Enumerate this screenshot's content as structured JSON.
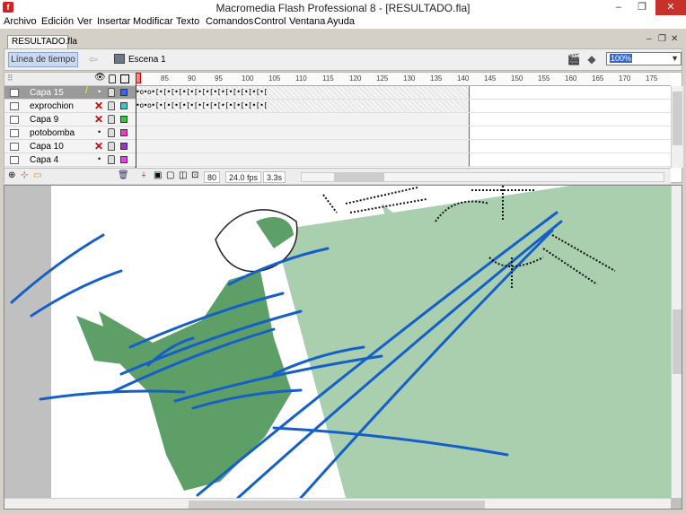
{
  "window": {
    "title": "Macromedia Flash Professional 8 - [RESULTADO.fla]",
    "app_icon": "flash-icon",
    "controls": [
      "minimize",
      "restore",
      "close"
    ]
  },
  "menu": [
    "Archivo",
    "Edición",
    "Ver",
    "Insertar",
    "Modificar",
    "Texto",
    "Comandos",
    "Control",
    "Ventana",
    "Ayuda"
  ],
  "document": {
    "tab_label": "RESULTADO.fla"
  },
  "editbar": {
    "timeline_button": "Línea de tiempo",
    "scene_label": "Escena 1",
    "zoom_value": "100%"
  },
  "timeline": {
    "ruler_ticks": [
      "85",
      "90",
      "95",
      "100",
      "105",
      "110",
      "115",
      "120",
      "125",
      "130",
      "135",
      "140",
      "145",
      "150",
      "155",
      "160",
      "165",
      "170",
      "175"
    ],
    "layers": [
      {
        "name": "Capa 15",
        "selected": true,
        "hidden": false,
        "color": "#3366ff",
        "keyframes": true
      },
      {
        "name": "exprochion",
        "selected": false,
        "hidden": true,
        "color": "#33cccc",
        "keyframes": true
      },
      {
        "name": "Capa 9",
        "selected": false,
        "hidden": true,
        "color": "#33cc33",
        "keyframes": false
      },
      {
        "name": "potobomba",
        "selected": false,
        "hidden": false,
        "color": "#ff33cc",
        "keyframes": false
      },
      {
        "name": "Capa 10",
        "selected": false,
        "hidden": true,
        "color": "#9933cc",
        "keyframes": false
      },
      {
        "name": "Capa 4",
        "selected": false,
        "hidden": false,
        "color": "#ff33ff",
        "keyframes": false
      }
    ],
    "keyframe_pattern": "•o•o•[•[•[•[•[•[•[•[•[•[•[•[•[•[•[",
    "current_frame": "80",
    "frame_rate": "24.0 fps",
    "elapsed": "3.3s"
  },
  "colors": {
    "stage_green": "#a9cfae",
    "figure_green": "#5e9f67",
    "stroke_blue": "#1560c8"
  }
}
